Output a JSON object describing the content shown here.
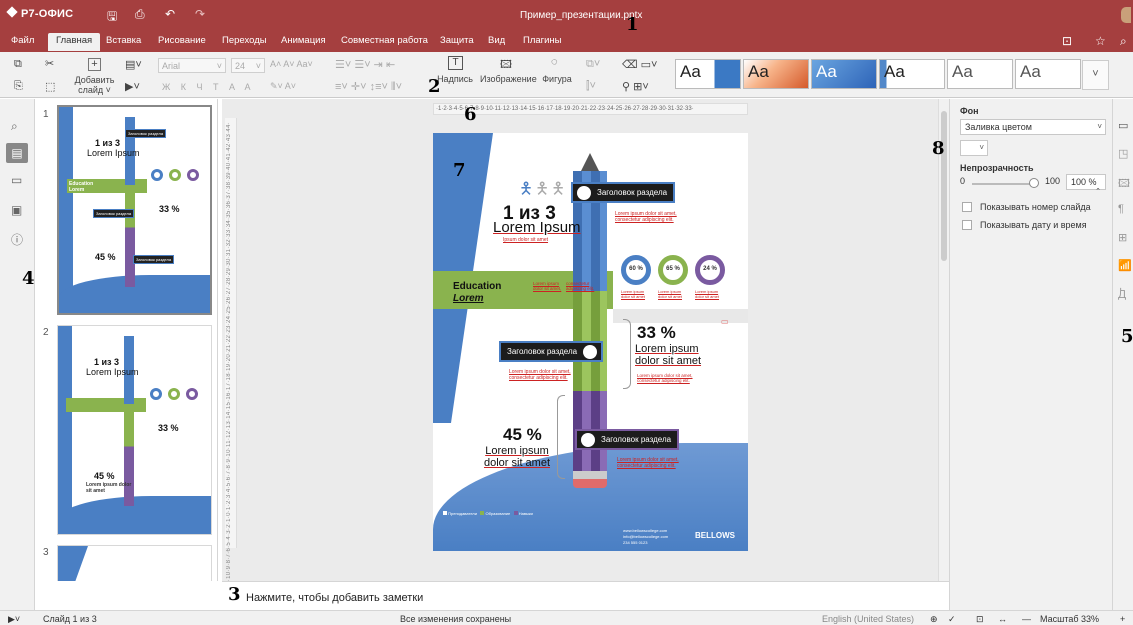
{
  "app": {
    "logo": "Р7-ОФИС",
    "doc_title": "Пример_презентации.pptx"
  },
  "menu": {
    "tabs": [
      "Файл",
      "Главная",
      "Вставка",
      "Рисование",
      "Переходы",
      "Анимация",
      "Совместная работа",
      "Защита",
      "Вид",
      "Плагины"
    ],
    "active": "Главная"
  },
  "toolbar": {
    "add_slide_line1": "Добавить",
    "add_slide_line2": "слайд",
    "font_name": "Arial",
    "font_size": "24",
    "insert_caption": "Надпись",
    "insert_image": "Изображение",
    "insert_shape": "Фигура",
    "themes": [
      "Aa",
      "Aa",
      "Aa",
      "Aa",
      "Aa",
      "Aa"
    ],
    "font_format_buttons": [
      "Ж",
      "К",
      "Ч",
      "Т",
      "A",
      "A"
    ]
  },
  "thumbnails": {
    "numbers": [
      "1",
      "2",
      "3"
    ],
    "mini_title": "1 из 3",
    "mini_sub": "Lorem Ipsum",
    "mini_edu": "Education",
    "mini_edu2": "Lorem",
    "mini_pct1": "33 %",
    "mini_pct2": "45 %",
    "mini_lorem": "Lorem ipsum dolor sit amet"
  },
  "ruler": {
    "horizontal": "·1·2·3·4·5·6·7·8·9·10·11·12·13·14·15·16·17·18·19·20·21·22·23·24·25·26·27·28·29·30·31·32·33·",
    "vertical": "·14·13·12·11·10·9·8·7·6·5·4·3·2·1·0·1·2·3·4·5·6·7·8·9·10·11·12·13·14·15·16·17·18·19·20·21·22·23·24·25·26·27·28·29·30·31·32·33·34·35·36·37·38·39·40·41·42·43·44·"
  },
  "slide": {
    "counter": "1 из 3",
    "subtitle": "Lorem Ipsum",
    "small": "Ipsum dolor sit amet",
    "section_header": "Заголовок раздела",
    "edu_title": "Education",
    "edu_sub": "Lorem",
    "edu_col1": "Lorem ipsum dolor sit amet,",
    "edu_col2": "consectetur adipiscing elit.",
    "donuts": [
      "60 %",
      "65 %",
      "24 %"
    ],
    "donut_caption": "Lorem ipsum dolor sit amet",
    "pct1": "33 %",
    "pct1_text": "Lorem ipsum dolor sit amet",
    "pct2": "45 %",
    "pct2_text": "Lorem ipsum dolor sit amet",
    "body_small": "Lorem ipsum dolor sit amet, consectetur adipiscing elit.",
    "brand": "BELLOWS",
    "contact1": "www.bellowscollege.com",
    "contact2": "info@bellowscollege.com",
    "contact3": "234 555 0123",
    "legend": [
      "Преподаватели",
      "Образование",
      "Навыки"
    ]
  },
  "notes": {
    "placeholder": "Нажмите, чтобы добавить заметки"
  },
  "right_panel": {
    "bg_label": "Фон",
    "fill_value": "Заливка цветом",
    "opacity_label": "Непрозрачность",
    "slider_min": "0",
    "slider_max": "100",
    "opacity_value": "100 %",
    "opacity_level": 1.0,
    "show_slide_number": "Показывать номер слайда",
    "show_datetime": "Показывать дату и время"
  },
  "statusbar": {
    "slide_info": "Слайд 1 из 3",
    "save_status": "Все изменения сохранены",
    "language": "English (United States)",
    "zoom": "Масштаб 33%"
  },
  "annotations": [
    "1",
    "2",
    "3",
    "4",
    "5",
    "6",
    "7",
    "8"
  ],
  "colors": {
    "brand": "#a53f3f",
    "toolbar_bg": "#f1f1f1",
    "slide_blue": "#4a7fc4",
    "slide_green": "#8ab34e",
    "slide_purple": "#7a5aa0"
  },
  "icons": [
    "undo-icon",
    "redo-icon",
    "save-icon",
    "print-icon",
    "search-icon",
    "star-icon",
    "open-location-icon"
  ]
}
